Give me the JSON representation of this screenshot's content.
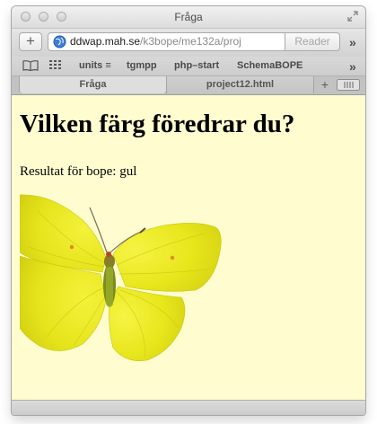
{
  "window": {
    "title": "Fråga"
  },
  "toolbar": {
    "url_domain": "ddwap.mah.se",
    "url_path": "/k3bope/me132a/proj",
    "reader_label": "Reader"
  },
  "bookmarks": {
    "items": [
      {
        "label": "units"
      },
      {
        "label": "tgmpp"
      },
      {
        "label": "php–start"
      },
      {
        "label": "SchemaBOPE"
      }
    ]
  },
  "tabs": [
    {
      "label": "Fråga",
      "active": true
    },
    {
      "label": "project12.html",
      "active": false
    }
  ],
  "page": {
    "heading": "Vilken färg föredrar du?",
    "result_text": "Resultat för bope: gul",
    "background_color": "#fffdd0"
  },
  "colors": {
    "butterfly_wing": "#e8e61a",
    "page_background": "#fffdd0"
  },
  "icons": {
    "globe": "globe-icon",
    "reload": "reload-icon",
    "fullscreen": "fullscreen-icon",
    "bookmarks": "book-icon",
    "top_sites": "grid-icon"
  }
}
